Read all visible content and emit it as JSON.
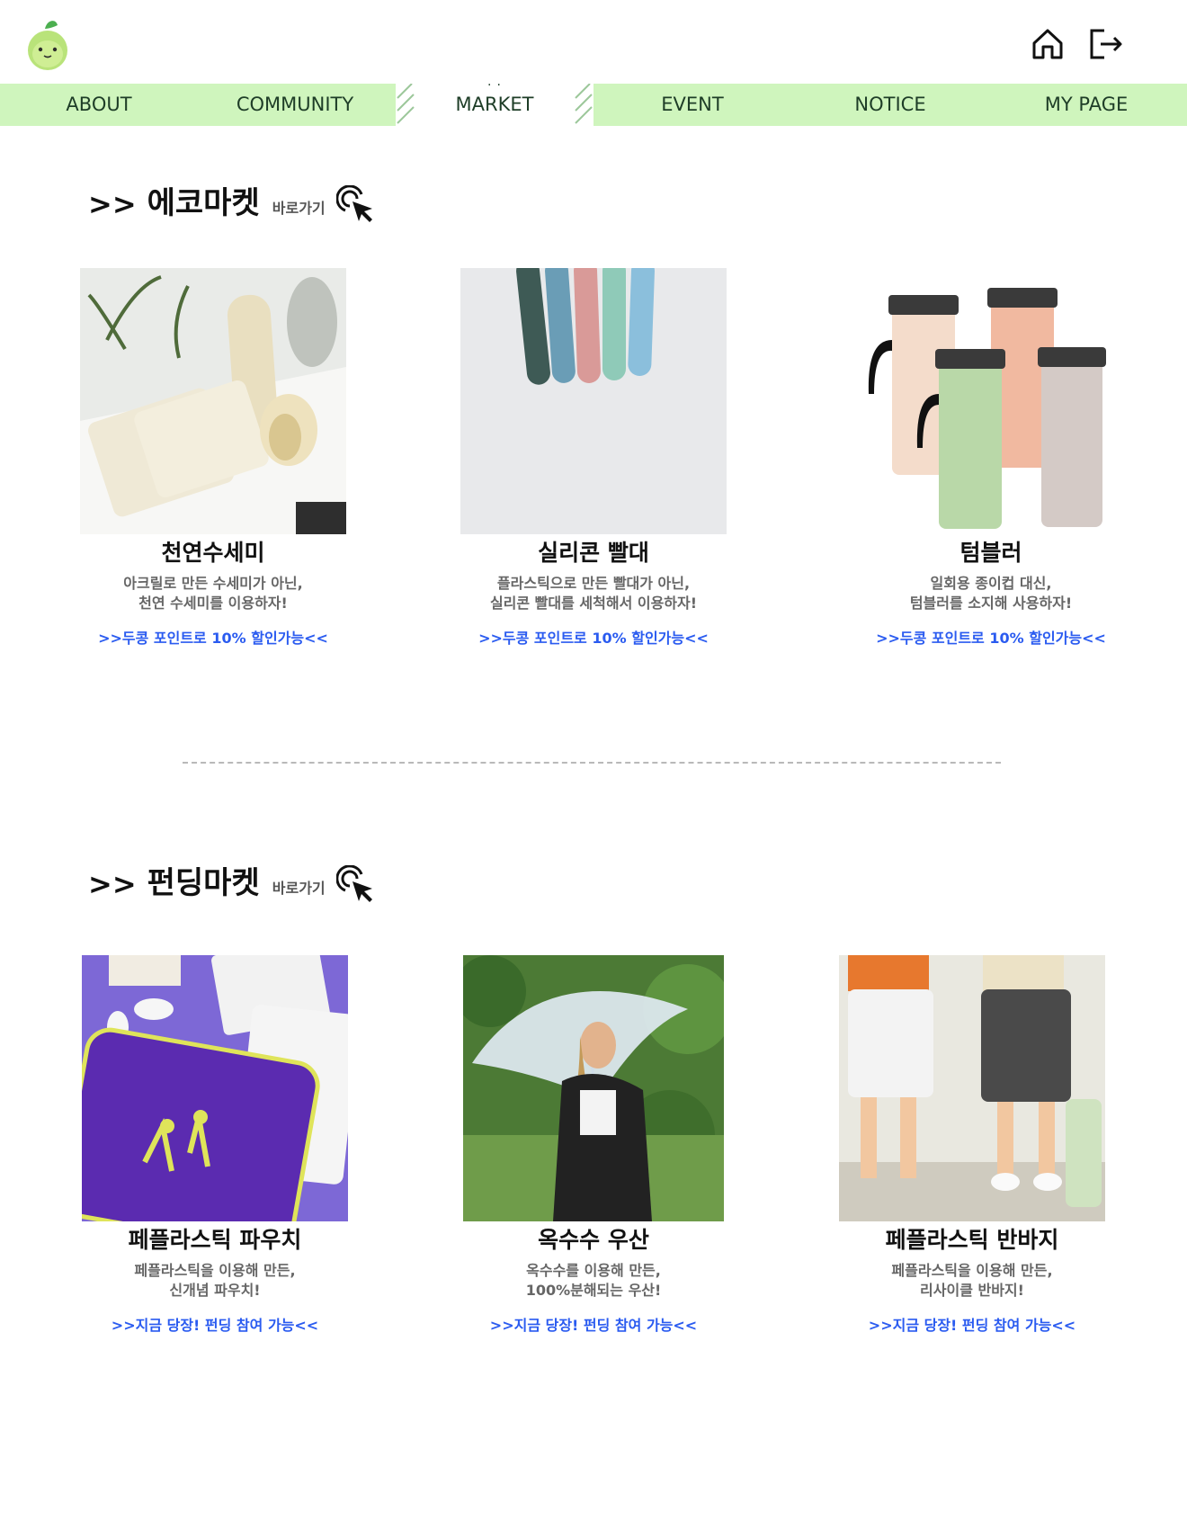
{
  "logo": {
    "icon": "bean-mascot-logo"
  },
  "header": {
    "icons": [
      {
        "name": "home-icon"
      },
      {
        "name": "logout-icon"
      }
    ]
  },
  "nav": {
    "items": [
      "ABOUT",
      "COMMUNITY",
      "MARKET",
      "EVENT",
      "NOTICE",
      "MY PAGE"
    ],
    "active": "MARKET",
    "colors": {
      "bar": "#cff5bd",
      "text": "#1e3d27"
    }
  },
  "eco": {
    "arrows": ">>",
    "title": "에코마켓",
    "go": "바로가기",
    "products": [
      {
        "title": "천연수세미",
        "desc": "아크릴로 만든 수세미가 아닌,\n천연 수세미를 이용하자!",
        "promo": ">>두콩 포인트로 10% 할인가능<<"
      },
      {
        "title": "실리콘 빨대",
        "desc": "플라스틱으로 만든 빨대가 아닌,\n실리콘 빨대를 세척해서 이용하자!",
        "promo": ">>두콩 포인트로 10% 할인가능<<"
      },
      {
        "title": "텀블러",
        "desc": "일회용 종이컵 대신,\n텀블러를 소지해 사용하자!",
        "promo": ">>두콩 포인트로 10% 할인가능<<"
      }
    ]
  },
  "funding": {
    "arrows": ">>",
    "title": "펀딩마켓",
    "go": "바로가기",
    "products": [
      {
        "title": "페플라스틱 파우치",
        "desc": "페플라스틱을 이용해 만든,\n신개념 파우치!",
        "promo": ">>지금 당장! 펀딩 참여 가능<<"
      },
      {
        "title": "옥수수 우산",
        "desc": "옥수수를 이용해 만든,\n100%분해되는 우산!",
        "promo": ">>지금 당장! 펀딩 참여 가능<<"
      },
      {
        "title": "페플라스틱 반바지",
        "desc": "페플라스틱을 이용해 만든,\n리사이클 반바지!",
        "promo": ">>지금 당장! 펀딩 참여 가능<<"
      }
    ]
  },
  "colors": {
    "promo": "#2a5bf0",
    "accent_green": "#cff5bd"
  }
}
